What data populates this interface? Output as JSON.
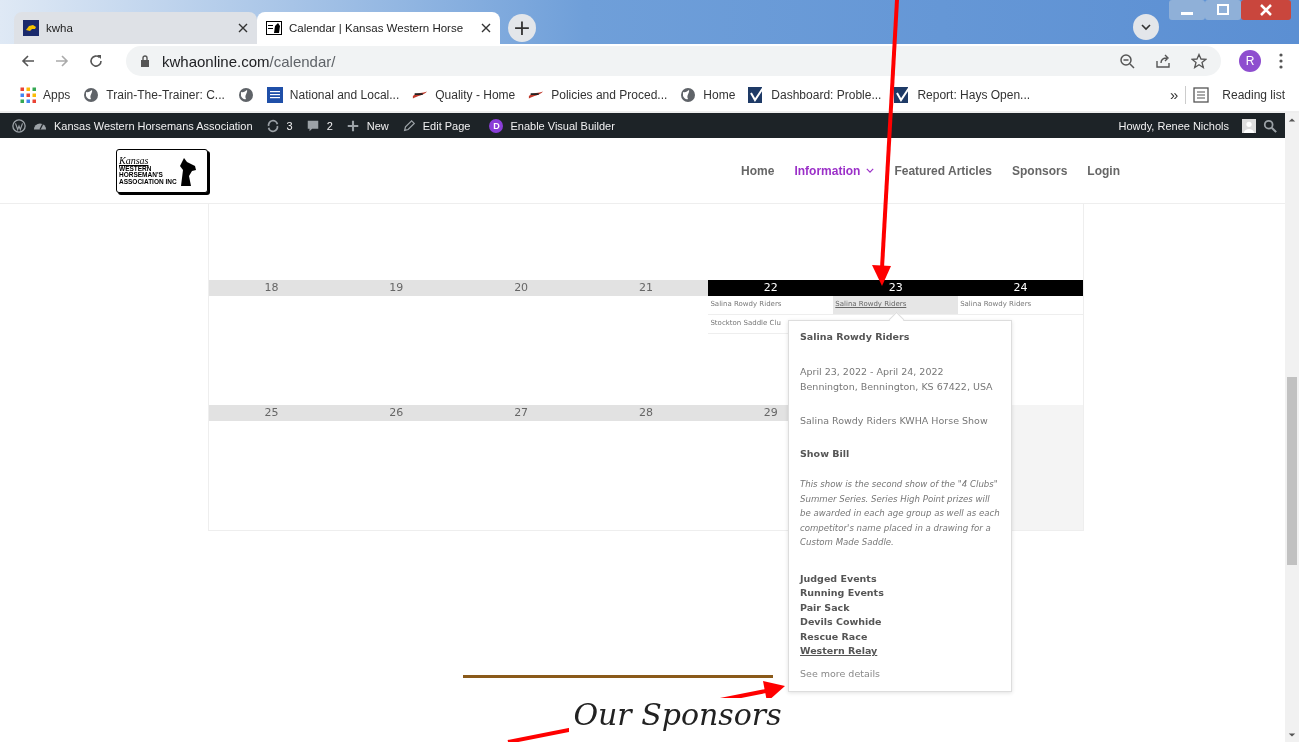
{
  "browser": {
    "tabs": [
      {
        "title": "kwha",
        "selected": false
      },
      {
        "title": "Calendar | Kansas Western Horse",
        "selected": true
      }
    ],
    "new_tab": "+",
    "url": {
      "domain": "kwhaonline.com",
      "path": "/calendar/"
    },
    "profile_initial": "R",
    "bookmarks": [
      {
        "kind": "apps",
        "label": "Apps"
      },
      {
        "kind": "globe",
        "label": "Train-The-Trainer: C..."
      },
      {
        "kind": "globe"
      },
      {
        "kind": "weather",
        "label": "National and Local..."
      },
      {
        "kind": "flag",
        "label": "Quality - Home"
      },
      {
        "kind": "flag",
        "label": "Policies and Proced..."
      },
      {
        "kind": "globe",
        "label": "Home"
      },
      {
        "kind": "check",
        "label": "Dashboard: Proble..."
      },
      {
        "kind": "check",
        "label": "Report: Hays Open..."
      }
    ],
    "overflow": "»",
    "reading_list": "Reading list"
  },
  "admin_bar": {
    "site": "Kansas Western Horsemans Association",
    "updates": "3",
    "comments": "2",
    "new": "New",
    "edit": "Edit Page",
    "builder_badge": "D",
    "builder": "Enable Visual Builder",
    "greeting": "Howdy, Renee Nichols"
  },
  "site": {
    "logo": {
      "script": "Kansas",
      "lines": [
        "WESTERN",
        "HORSEMAN'S",
        "ASSOCIATION INC"
      ]
    },
    "nav": [
      {
        "label": "Home",
        "selected": false,
        "dropdown": false
      },
      {
        "label": "Information",
        "selected": true,
        "dropdown": true
      },
      {
        "label": "Featured Articles",
        "selected": false,
        "dropdown": false
      },
      {
        "label": "Sponsors",
        "selected": false,
        "dropdown": false
      },
      {
        "label": "Login",
        "selected": false,
        "dropdown": false
      }
    ]
  },
  "calendar": {
    "weeks": [
      {
        "days": [
          {
            "kind": "day",
            "number": "18",
            "highlighted": false
          },
          {
            "kind": "day",
            "number": "19",
            "highlighted": false
          },
          {
            "kind": "day",
            "number": "20",
            "highlighted": false
          },
          {
            "kind": "day",
            "number": "21",
            "highlighted": false
          },
          {
            "kind": "day",
            "number": "22",
            "highlighted": true,
            "events": [
              {
                "title": "Salina Rowdy Riders",
                "selected": false
              },
              {
                "title": "Stockton Saddle Clu",
                "selected": false
              }
            ]
          },
          {
            "kind": "day",
            "number": "23",
            "highlighted": true,
            "events": [
              {
                "title": "Salina Rowdy Riders",
                "selected": true
              }
            ]
          },
          {
            "kind": "day",
            "number": "24",
            "highlighted": true,
            "events": [
              {
                "title": "Salina Rowdy Riders",
                "selected": false
              }
            ]
          }
        ]
      },
      {
        "days": [
          {
            "kind": "day",
            "number": "25",
            "highlighted": false
          },
          {
            "kind": "day",
            "number": "26",
            "highlighted": false
          },
          {
            "kind": "day",
            "number": "27",
            "highlighted": false
          },
          {
            "kind": "day",
            "number": "28",
            "highlighted": false
          },
          {
            "kind": "day",
            "number": "29",
            "highlighted": false
          },
          {
            "kind": "outside"
          },
          {
            "kind": "outside"
          }
        ]
      }
    ]
  },
  "popup": {
    "title": "Salina Rowdy Riders",
    "dates": "April 23, 2022 - April 24, 2022",
    "location": "Bennington, Bennington, KS 67422, USA",
    "summary": "Salina Rowdy Riders KWHA Horse Show",
    "section": "Show Bill",
    "description": "This show is the second show of the \"4 Clubs\" Summer Series. Series High Point prizes will be awarded in each age group as well as each competitor's name placed in a drawing for a Custom Made Saddle.",
    "events": [
      {
        "label": "Judged Events",
        "link": false
      },
      {
        "label": "Running Events",
        "link": false
      },
      {
        "label": "Pair Sack",
        "link": false
      },
      {
        "label": "Devils Cowhide",
        "link": false
      },
      {
        "label": "Rescue Race",
        "link": false
      },
      {
        "label": "Western Relay",
        "link": true
      }
    ],
    "more": "See more details"
  },
  "sponsors": {
    "heading": "Our Sponsors"
  }
}
